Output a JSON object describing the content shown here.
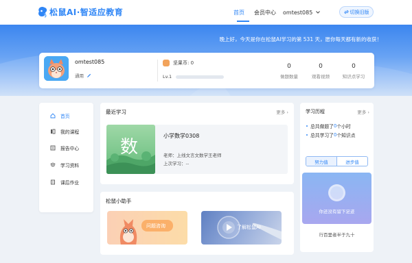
{
  "header": {
    "logo_text": "松鼠AI·智适应教育",
    "logo_small": "Squirrel AI",
    "nav": [
      {
        "label": "首页",
        "active": true
      },
      {
        "label": "会员中心",
        "active": false
      }
    ],
    "username": "omtest085",
    "switch_label": "切换旧版"
  },
  "banner": {
    "greeting": "晚上好，今天是你在松鼠AI学习的第 531 天，愿你每天都有新的收获！"
  },
  "profile": {
    "name": "omtest085",
    "tag": "通用",
    "coins_label": "坚果币: 0",
    "level_label": "Lv.1",
    "level_progress": 0,
    "stats": [
      {
        "value": "0",
        "label": "做题数量"
      },
      {
        "value": "0",
        "label": "观看视频"
      },
      {
        "value": "0",
        "label": "知识点学习"
      }
    ]
  },
  "sidebar": {
    "items": [
      {
        "label": "首页",
        "icon": "home-icon",
        "active": true
      },
      {
        "label": "我的课程",
        "icon": "courses-icon",
        "active": false
      },
      {
        "label": "报告中心",
        "icon": "report-icon",
        "active": false
      },
      {
        "label": "学习资料",
        "icon": "materials-icon",
        "active": false
      },
      {
        "label": "课后作业",
        "icon": "homework-icon",
        "active": false
      }
    ]
  },
  "recent": {
    "title": "最近学习",
    "more": "更多",
    "course": {
      "thumb_char": "数",
      "name": "小学数学0308",
      "teacher": "老师：上线文言文数学王老师",
      "last_study": "上次学习：--"
    }
  },
  "helper": {
    "title": "松鼠小助手",
    "cards": [
      {
        "label": "问题咨询"
      },
      {
        "label": "了解松鼠AI"
      }
    ]
  },
  "history": {
    "title": "学习历程",
    "more": "更多",
    "line1": {
      "prefix": "总共做题了",
      "value": "0",
      "suffix": "个小时"
    },
    "line2": {
      "prefix": "总共学习了",
      "value": "0",
      "suffix": "个知识点"
    },
    "tabs": [
      {
        "label": "努力值",
        "active": true
      },
      {
        "label": "进步值",
        "active": false
      }
    ],
    "empty_text": "你还没有留下足迹",
    "motto": "行百里者半于九十"
  },
  "colors": {
    "brand": "#2f86f6",
    "banner_top": "#3c86ef",
    "coin": "#f2a35b"
  }
}
